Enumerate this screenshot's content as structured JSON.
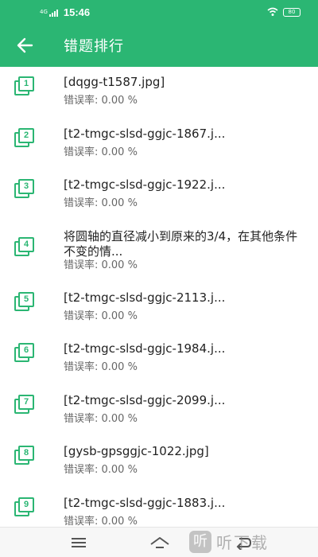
{
  "status_bar": {
    "network": "4G",
    "time": "15:46",
    "battery": "80"
  },
  "toolbar": {
    "back_icon": "arrow-left-icon",
    "title": "错题排行"
  },
  "colors": {
    "accent": "#2bb673"
  },
  "items": [
    {
      "index": "1",
      "title": "[dqgg-t1587.jpg]",
      "rate": "错误率:  0.00 %"
    },
    {
      "index": "2",
      "title": "[t2-tmgc-slsd-ggjc-1867.j...",
      "rate": "错误率:  0.00 %"
    },
    {
      "index": "3",
      "title": "[t2-tmgc-slsd-ggjc-1922.j...",
      "rate": "错误率:  0.00 %"
    },
    {
      "index": "4",
      "title": "将圆轴的直径减小到原来的3/4，在其他条件不变的情...",
      "rate": "错误率:  0.00 %"
    },
    {
      "index": "5",
      "title": "[t2-tmgc-slsd-ggjc-2113.j...",
      "rate": "错误率:  0.00 %"
    },
    {
      "index": "6",
      "title": "[t2-tmgc-slsd-ggjc-1984.j...",
      "rate": "错误率:  0.00 %"
    },
    {
      "index": "7",
      "title": "[t2-tmgc-slsd-ggjc-2099.j...",
      "rate": "错误率:  0.00 %"
    },
    {
      "index": "8",
      "title": "[gysb-gpsggjc-1022.jpg]",
      "rate": "错误率:  0.00 %"
    },
    {
      "index": "9",
      "title": "[t2-tmgc-slsd-ggjc-1883.j...",
      "rate": "错误率:  0.00 %"
    }
  ],
  "watermark": {
    "logo": "听",
    "text": "听下载"
  }
}
